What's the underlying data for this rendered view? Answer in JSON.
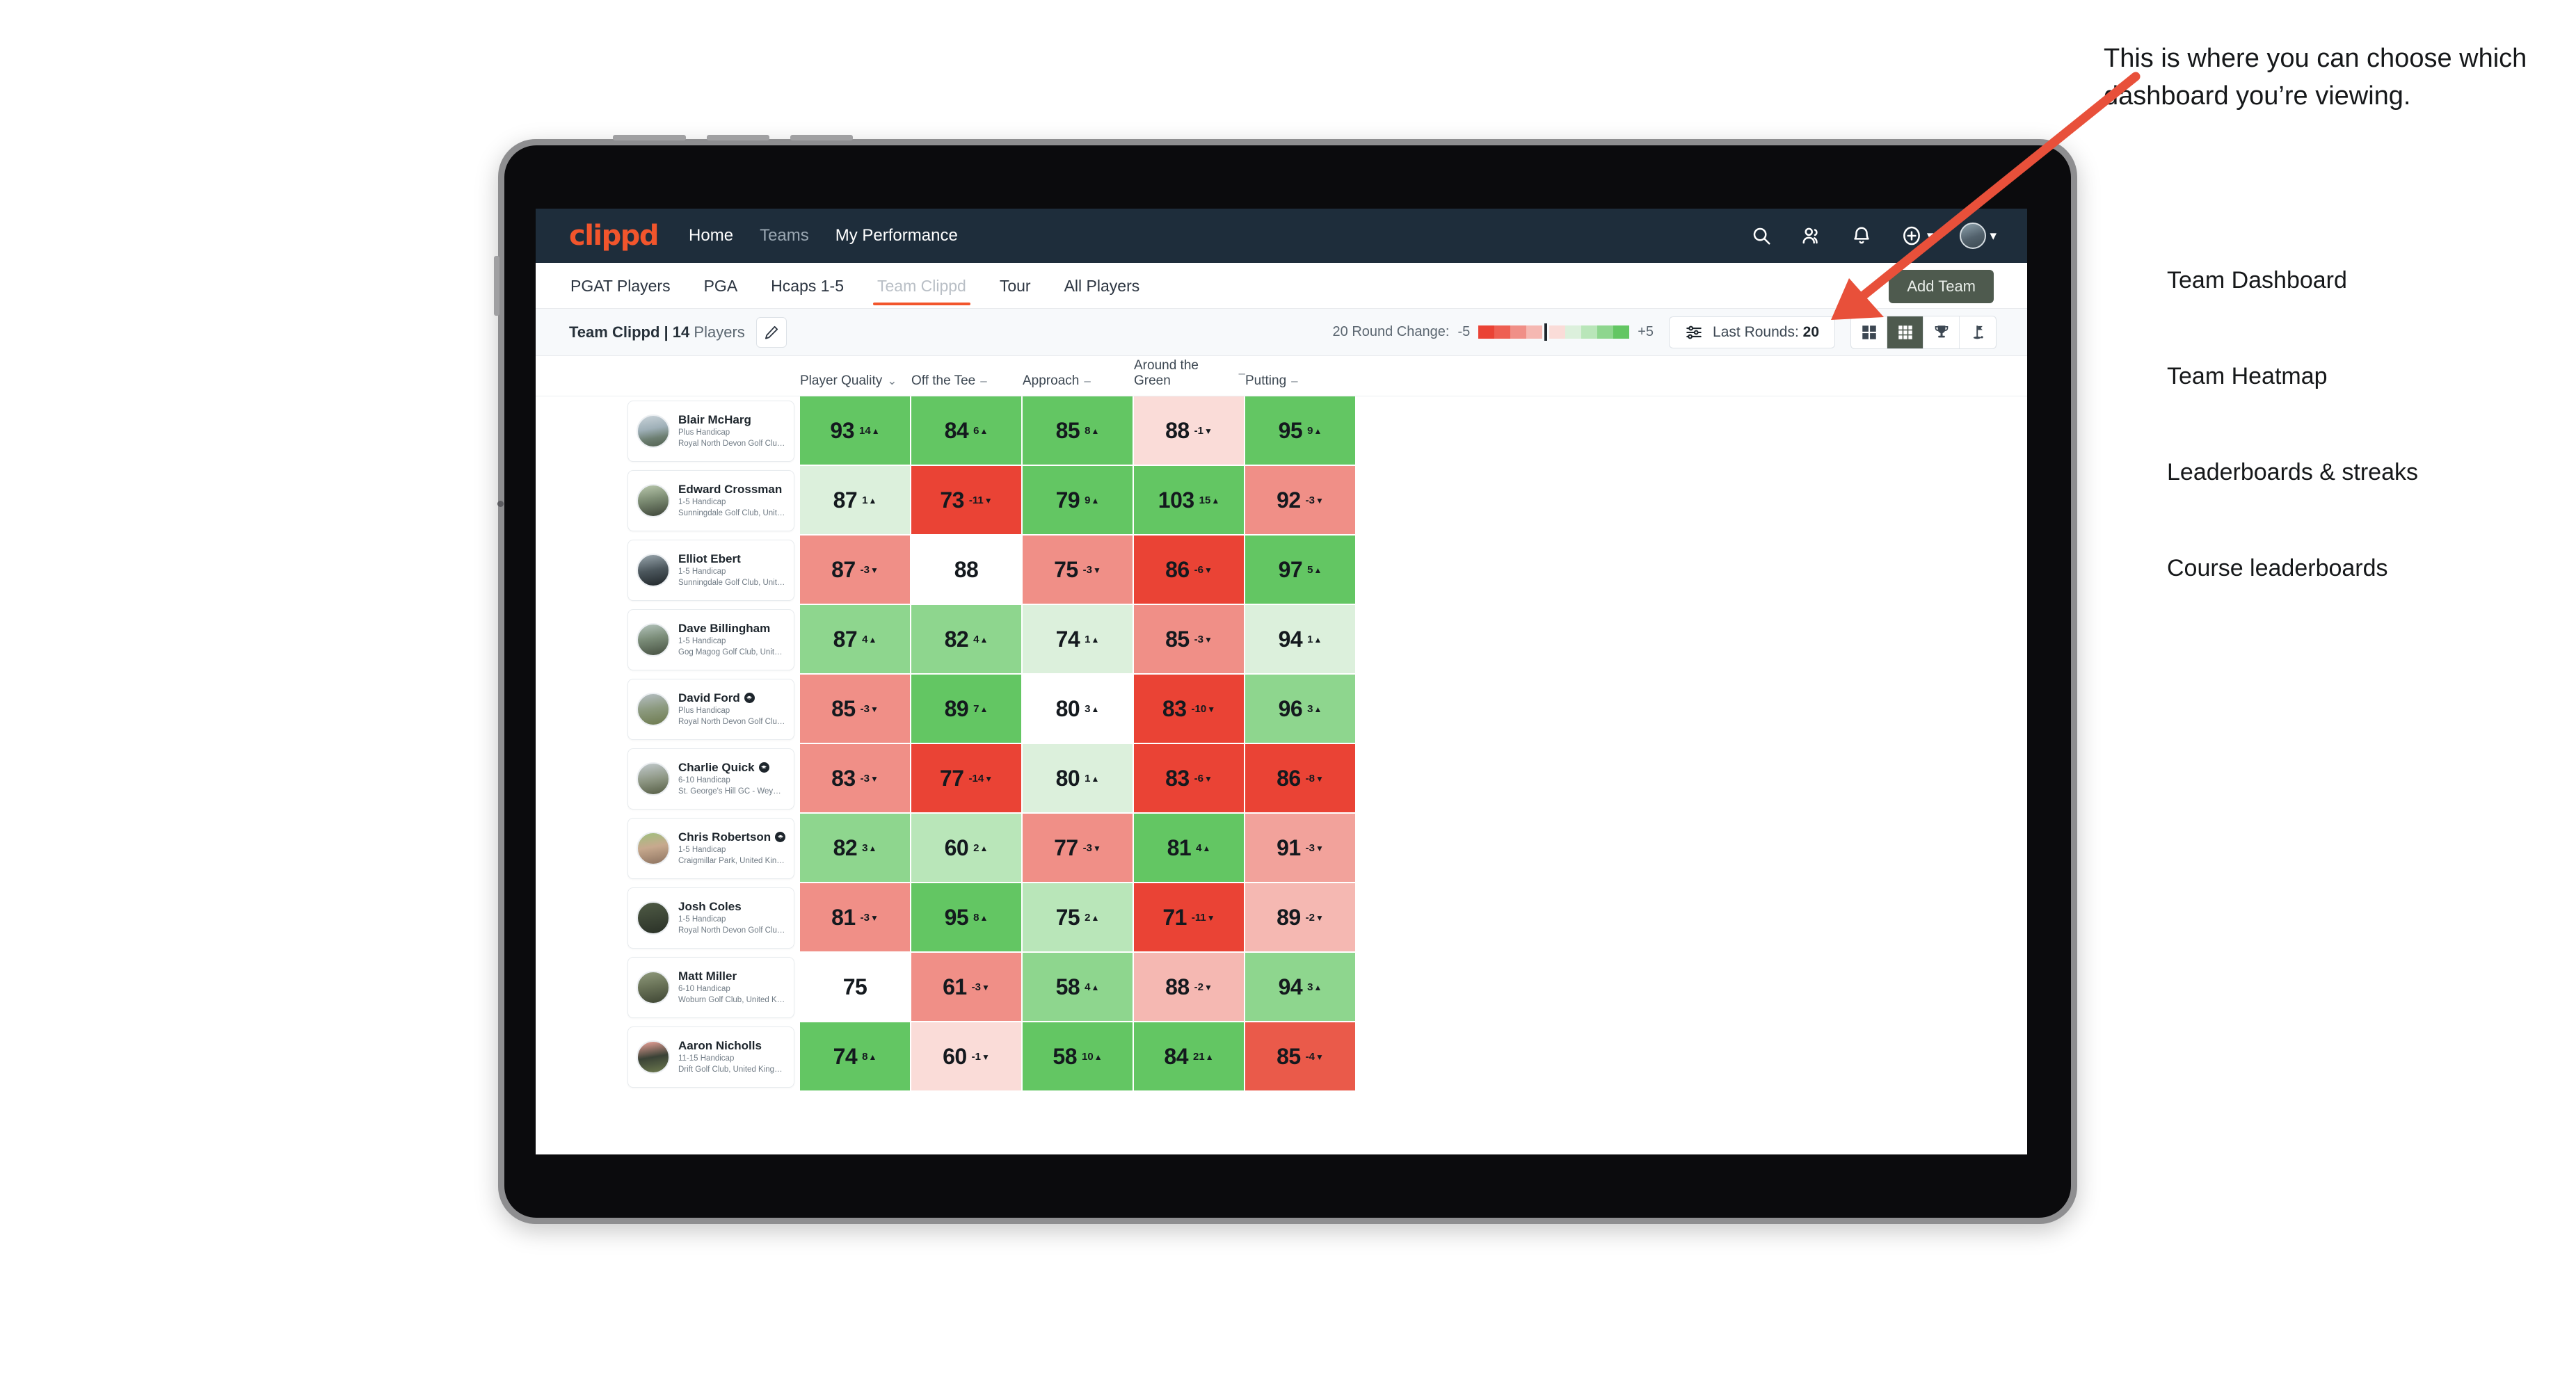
{
  "navbar": {
    "logo": "clippd",
    "links": [
      {
        "label": "Home",
        "dim": false
      },
      {
        "label": "Teams",
        "dim": true
      },
      {
        "label": "My Performance",
        "dim": false
      }
    ],
    "icons": [
      "search-icon",
      "people-icon",
      "bell-icon",
      "plus-circle-icon",
      "avatar"
    ]
  },
  "tabs": [
    {
      "label": "PGAT Players",
      "active": false
    },
    {
      "label": "PGA",
      "active": false
    },
    {
      "label": "Hcaps 1-5",
      "active": false
    },
    {
      "label": "Team Clippd",
      "active": true
    },
    {
      "label": "Tour",
      "active": false
    },
    {
      "label": "All Players",
      "active": false
    }
  ],
  "add_team_label": "Add Team",
  "toolbar": {
    "team_name": "Team Clippd",
    "separator": "|",
    "player_count": "14",
    "players_word": "Players",
    "edit_icon": "pencil-icon",
    "round_change_label": "20 Round Change:",
    "scale_min": "-5",
    "scale_max": "+5",
    "last_rounds_label": "Last Rounds:",
    "last_rounds_value": "20",
    "filter_icon": "sliders-icon",
    "views": [
      {
        "name": "team-dashboard",
        "icon": "grid-2x2-icon",
        "active": false
      },
      {
        "name": "team-heatmap",
        "icon": "grid-3x3-icon",
        "active": true
      },
      {
        "name": "leaderboards-streaks",
        "icon": "trophy-icon",
        "active": false
      },
      {
        "name": "course-leaderboards",
        "icon": "golf-flag-icon",
        "active": false
      }
    ]
  },
  "columns": [
    {
      "label": "Player Quality",
      "marker": "⌄"
    },
    {
      "label": "Off the Tee",
      "marker": "–"
    },
    {
      "label": "Approach",
      "marker": "–"
    },
    {
      "label": "Around the Green",
      "marker": "–"
    },
    {
      "label": "Putting",
      "marker": "–"
    }
  ],
  "rows": [
    {
      "name": "Blair McHarg",
      "badge": false,
      "handicap": "Plus Handicap",
      "club": "Royal North Devon Golf Club, United Kingdom",
      "avatar_css": "linear-gradient(170deg,#c9d3d9 0%,#9fb0b8 42%,#6d7f72 70%,#51604f 100%)",
      "cells": [
        {
          "v": "93",
          "d": "14",
          "dir": "up",
          "bg": "#63c663"
        },
        {
          "v": "84",
          "d": "6",
          "dir": "up",
          "bg": "#63c663"
        },
        {
          "v": "85",
          "d": "8",
          "dir": "up",
          "bg": "#63c663"
        },
        {
          "v": "88",
          "d": "-1",
          "dir": "down",
          "bg": "#fadcd8"
        },
        {
          "v": "95",
          "d": "9",
          "dir": "up",
          "bg": "#63c663"
        }
      ]
    },
    {
      "name": "Edward Crossman",
      "badge": false,
      "handicap": "1-5 Handicap",
      "club": "Sunningdale Golf Club, United Kingdom",
      "avatar_css": "linear-gradient(170deg,#b9c8ad 0%,#7d8d74 45%,#3d4438 100%)",
      "cells": [
        {
          "v": "87",
          "d": "1",
          "dir": "up",
          "bg": "#dcf0dc"
        },
        {
          "v": "73",
          "d": "-11",
          "dir": "down",
          "bg": "#ea4335"
        },
        {
          "v": "79",
          "d": "9",
          "dir": "up",
          "bg": "#63c663"
        },
        {
          "v": "103",
          "d": "15",
          "dir": "up",
          "bg": "#63c663"
        },
        {
          "v": "92",
          "d": "-3",
          "dir": "down",
          "bg": "#f08f87"
        }
      ]
    },
    {
      "name": "Elliot Ebert",
      "badge": false,
      "handicap": "1-5 Handicap",
      "club": "Sunningdale Golf Club, United Kingdom",
      "avatar_css": "linear-gradient(170deg,#9aa7ae 0%,#4b565c 50%,#20262a 100%)",
      "cells": [
        {
          "v": "87",
          "d": "-3",
          "dir": "down",
          "bg": "#f08f87"
        },
        {
          "v": "88",
          "d": "",
          "dir": "",
          "bg": "#ffffff"
        },
        {
          "v": "75",
          "d": "-3",
          "dir": "down",
          "bg": "#f08f87"
        },
        {
          "v": "86",
          "d": "-6",
          "dir": "down",
          "bg": "#ea4335"
        },
        {
          "v": "97",
          "d": "5",
          "dir": "up",
          "bg": "#63c663"
        }
      ]
    },
    {
      "name": "Dave Billingham",
      "badge": false,
      "handicap": "1-5 Handicap",
      "club": "Gog Magog Golf Club, United Kingdom",
      "avatar_css": "linear-gradient(170deg,#b4c4bc 0%,#7b8d79 45%,#454f40 100%)",
      "cells": [
        {
          "v": "87",
          "d": "4",
          "dir": "up",
          "bg": "#8ed68e"
        },
        {
          "v": "82",
          "d": "4",
          "dir": "up",
          "bg": "#8ed68e"
        },
        {
          "v": "74",
          "d": "1",
          "dir": "up",
          "bg": "#dcf0dc"
        },
        {
          "v": "85",
          "d": "-3",
          "dir": "down",
          "bg": "#f08f87"
        },
        {
          "v": "94",
          "d": "1",
          "dir": "up",
          "bg": "#dcf0dc"
        }
      ]
    },
    {
      "name": "David Ford",
      "badge": true,
      "handicap": "Plus Handicap",
      "club": "Royal North Devon Golf Club, United Kingdom",
      "avatar_css": "linear-gradient(170deg,#b6bfc4 0%,#8c9a7f 48%,#6d7a4e 100%)",
      "cells": [
        {
          "v": "85",
          "d": "-3",
          "dir": "down",
          "bg": "#f08f87"
        },
        {
          "v": "89",
          "d": "7",
          "dir": "up",
          "bg": "#63c663"
        },
        {
          "v": "80",
          "d": "3",
          "dir": "up",
          "bg": "#a8deа8"
        },
        {
          "v": "83",
          "d": "-10",
          "dir": "down",
          "bg": "#ea4335"
        },
        {
          "v": "96",
          "d": "3",
          "dir": "up",
          "bg": "#8ed68e"
        }
      ]
    },
    {
      "name": "Charlie Quick",
      "badge": true,
      "handicap": "6-10 Handicap",
      "club": "St. George's Hill GC - Weybridge - Surrey, Uni...",
      "avatar_css": "linear-gradient(170deg,#c2cacd 0%,#8d9683 52%,#555d44 100%)",
      "cells": [
        {
          "v": "83",
          "d": "-3",
          "dir": "down",
          "bg": "#f08f87"
        },
        {
          "v": "77",
          "d": "-14",
          "dir": "down",
          "bg": "#ea4335"
        },
        {
          "v": "80",
          "d": "1",
          "dir": "up",
          "bg": "#dcf0dc"
        },
        {
          "v": "83",
          "d": "-6",
          "dir": "down",
          "bg": "#ea4335"
        },
        {
          "v": "86",
          "d": "-8",
          "dir": "down",
          "bg": "#ea4335"
        }
      ]
    },
    {
      "name": "Chris Robertson",
      "badge": true,
      "handicap": "1-5 Handicap",
      "club": "Craigmillar Park, United Kingdom",
      "avatar_css": "linear-gradient(170deg,#9fc07d 0%,#c7a98e 45%,#8d7360 100%)",
      "cells": [
        {
          "v": "82",
          "d": "3",
          "dir": "up",
          "bg": "#8ed68e"
        },
        {
          "v": "60",
          "d": "2",
          "dir": "up",
          "bg": "#b9e6b9"
        },
        {
          "v": "77",
          "d": "-3",
          "dir": "down",
          "bg": "#f08f87"
        },
        {
          "v": "81",
          "d": "4",
          "dir": "up",
          "bg": "#63c663"
        },
        {
          "v": "91",
          "d": "-3",
          "dir": "down",
          "bg": "#f2a29b"
        }
      ]
    },
    {
      "name": "Josh Coles",
      "badge": false,
      "handicap": "1-5 Handicap",
      "club": "Royal North Devon Golf Club, United Kingdom",
      "avatar_css": "linear-gradient(170deg,#4f5b45 0%,#3b4435 55%,#2a3127 100%)",
      "cells": [
        {
          "v": "81",
          "d": "-3",
          "dir": "down",
          "bg": "#f08f87"
        },
        {
          "v": "95",
          "d": "8",
          "dir": "up",
          "bg": "#63c663"
        },
        {
          "v": "75",
          "d": "2",
          "dir": "up",
          "bg": "#b9e6b9"
        },
        {
          "v": "71",
          "d": "-11",
          "dir": "down",
          "bg": "#ea4335"
        },
        {
          "v": "89",
          "d": "-2",
          "dir": "down",
          "bg": "#f5b8b2"
        }
      ]
    },
    {
      "name": "Matt Miller",
      "badge": false,
      "handicap": "6-10 Handicap",
      "club": "Woburn Golf Club, United Kingdom",
      "avatar_css": "linear-gradient(170deg,#8f9a7c 0%,#6a7358 45%,#3f4634 100%)",
      "cells": [
        {
          "v": "75",
          "d": "",
          "dir": "",
          "bg": "#ffffff"
        },
        {
          "v": "61",
          "d": "-3",
          "dir": "down",
          "bg": "#f08f87"
        },
        {
          "v": "58",
          "d": "4",
          "dir": "up",
          "bg": "#8ed68e"
        },
        {
          "v": "88",
          "d": "-2",
          "dir": "down",
          "bg": "#f5b8b2"
        },
        {
          "v": "94",
          "d": "3",
          "dir": "up",
          "bg": "#8ed68e"
        }
      ]
    },
    {
      "name": "Aaron Nicholls",
      "badge": false,
      "handicap": "11-15 Handicap",
      "club": "Drift Golf Club, United Kingdom",
      "avatar_css": "linear-gradient(170deg,#f0a49b 0%,#3a4236 50%,#6d7a4e 100%)",
      "cells": [
        {
          "v": "74",
          "d": "8",
          "dir": "up",
          "bg": "#63c663"
        },
        {
          "v": "60",
          "d": "-1",
          "dir": "down",
          "bg": "#fadcd8"
        },
        {
          "v": "58",
          "d": "10",
          "dir": "up",
          "bg": "#63c663"
        },
        {
          "v": "84",
          "d": "21",
          "dir": "up",
          "bg": "#63c663"
        },
        {
          "v": "85",
          "d": "-4",
          "dir": "down",
          "bg": "#ea5a4a"
        }
      ]
    }
  ],
  "annotation": {
    "heading": "This is where you can choose which dashboard you’re viewing.",
    "items": [
      "Team Dashboard",
      "Team Heatmap",
      "Leaderboards & streaks",
      "Course leaderboards"
    ],
    "arrow_color": "#e8503a"
  },
  "colors": {
    "brand": "#f2552c",
    "navbar_bg": "#1e2d3b",
    "toolbar_bg": "#f7f9fb",
    "green_strong": "#63c663",
    "red_strong": "#ea4335",
    "scale_steps": [
      "#ea4335",
      "#ee5f52",
      "#f08f87",
      "#f5b8b2",
      "#fadcd8",
      "#dcf0dc",
      "#b9e6b9",
      "#8ed68e",
      "#63c663"
    ]
  }
}
